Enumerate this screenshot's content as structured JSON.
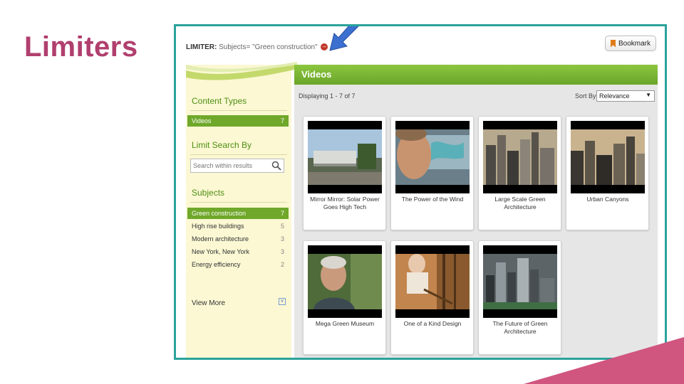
{
  "slide": {
    "title": "Limiters"
  },
  "limiter": {
    "label": "LIMITER:",
    "value": "Subjects= \"Green construction\""
  },
  "bookmark": {
    "label": "Bookmark"
  },
  "sidebar": {
    "content_types_heading": "Content Types",
    "content_types": [
      {
        "label": "Videos",
        "count": "7"
      }
    ],
    "limit_heading": "Limit Search By",
    "search_placeholder": "Search within results",
    "subjects_heading": "Subjects",
    "subjects": [
      {
        "label": "Green construction",
        "count": "7"
      },
      {
        "label": "High rise buildings",
        "count": "5"
      },
      {
        "label": "Modern architecture",
        "count": "3"
      },
      {
        "label": "New York, New York",
        "count": "3"
      },
      {
        "label": "Energy efficiency",
        "count": "2"
      }
    ],
    "view_more": "View More"
  },
  "main": {
    "header": "Videos",
    "displaying": "Displaying 1 - 7 of 7",
    "sort_label": "Sort By",
    "sort_value": "Relevance"
  },
  "videos": [
    {
      "title": "Mirror Mirror: Solar Power Goes High Tech"
    },
    {
      "title": "The Power of the Wind"
    },
    {
      "title": "Large Scale Green Architecture"
    },
    {
      "title": "Urban Canyons"
    },
    {
      "title": "Mega Green Museum"
    },
    {
      "title": "One of a Kind Design"
    },
    {
      "title": "The Future of Green Architecture"
    }
  ],
  "colors": {
    "title": "#b03f6e",
    "frame": "#2aa39b",
    "accent_green": "#6fa82a",
    "sidebar_bg": "#fbf8d3",
    "arrow": "#3b6fd0",
    "corner": "#d0557f"
  }
}
